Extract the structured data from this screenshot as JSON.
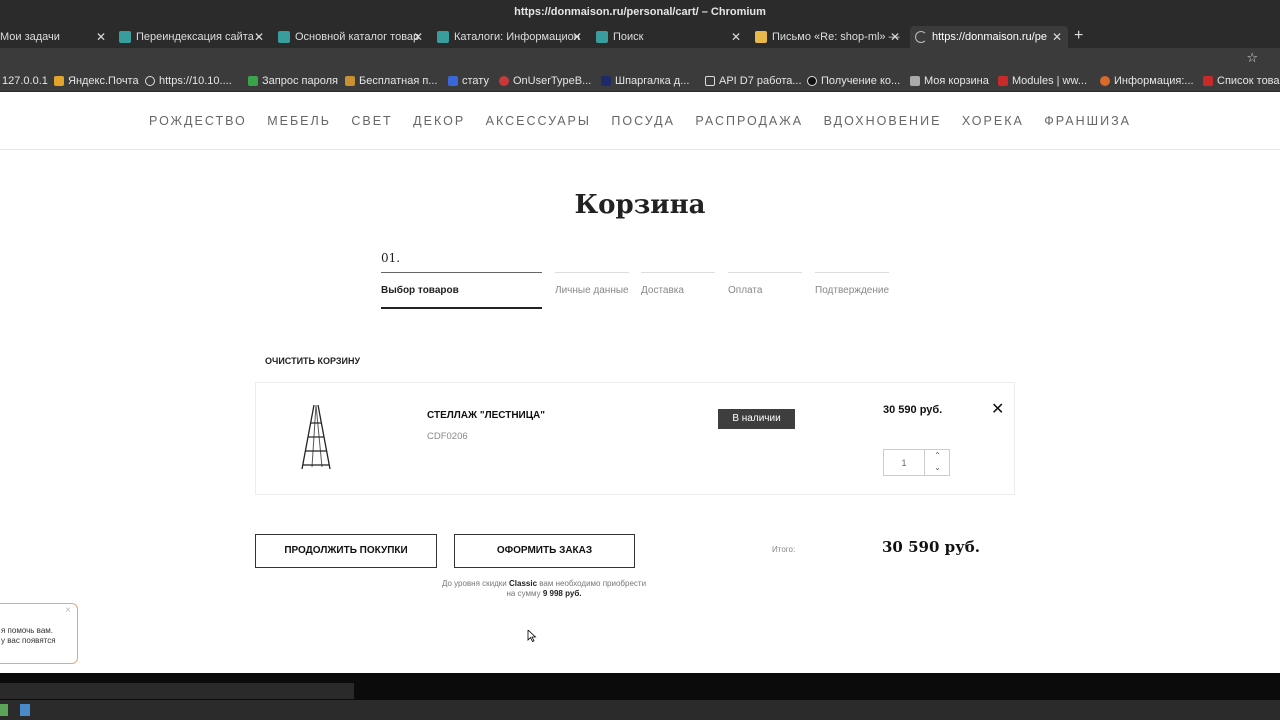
{
  "window": {
    "title": "https://donmaison.ru/personal/cart/ – Chromium"
  },
  "tabs": [
    {
      "label": "Мои задачи",
      "icon": "task-icon"
    },
    {
      "label": "Переиндексация сайта - ",
      "icon": "bitrix-icon"
    },
    {
      "label": "Основной каталог товар",
      "icon": "bitrix-icon"
    },
    {
      "label": "Каталоги: Информацион",
      "icon": "bitrix-icon"
    },
    {
      "label": "Поиск",
      "icon": "bitrix-icon"
    },
    {
      "label": "Письмо «Re: shop-ml» — ",
      "icon": "mail-icon"
    },
    {
      "label": "https://donmaison.ru/pe",
      "icon": "loading-icon"
    }
  ],
  "bookmarks": [
    {
      "label": "127.0.0.1"
    },
    {
      "label": "Яндекс.Почта"
    },
    {
      "label": "https://10.10...."
    },
    {
      "label": "Запрос пароля"
    },
    {
      "label": "Бесплатная п..."
    },
    {
      "label": "стату"
    },
    {
      "label": "OnUserTypeB..."
    },
    {
      "label": "Шпаргалка д..."
    },
    {
      "label": "API D7 работа..."
    },
    {
      "label": "Получение ко..."
    },
    {
      "label": "Моя корзина"
    },
    {
      "label": "Modules | ww..."
    },
    {
      "label": "Информация:..."
    },
    {
      "label": "Список товар"
    }
  ],
  "nav": [
    "РОЖДЕСТВО",
    "МЕБЕЛЬ",
    "СВЕТ",
    "ДЕКОР",
    "АКСЕССУАРЫ",
    "ПОСУДА",
    "РАСПРОДАЖА",
    "ВДОХНОВЕНИЕ",
    "ХОРЕКА",
    "ФРАНШИЗА"
  ],
  "page": {
    "title": "Корзина",
    "step_number": "01."
  },
  "steps": [
    "Выбор товаров",
    "Личные данные",
    "Доставка",
    "Оплата",
    "Подтверждение"
  ],
  "cart": {
    "clear_label": "Очистить корзину",
    "item": {
      "name": "Стеллаж \"Лестница\"",
      "sku": "CDF0206",
      "stock": "В наличии",
      "price": "30 590 руб.",
      "quantity": "1",
      "remove": "✕"
    },
    "continue_label": "Продолжить покупки",
    "checkout_label": "Оформить заказ",
    "total_label": "Итого:",
    "total_value": "30 590 руб.",
    "discount": {
      "pre": "До уровня скидки",
      "level": "Classic",
      "mid": "вам необходимо приобрести на сумму",
      "amount": "9 998 руб."
    }
  },
  "chat": {
    "line1": "я помочь вам.",
    "line2": "у вас появятся",
    "close": "×"
  },
  "colors": {
    "browser_dark": "#2b2b2b",
    "stock_bg": "#3e3e3e",
    "chat_border": "#e7a878"
  }
}
